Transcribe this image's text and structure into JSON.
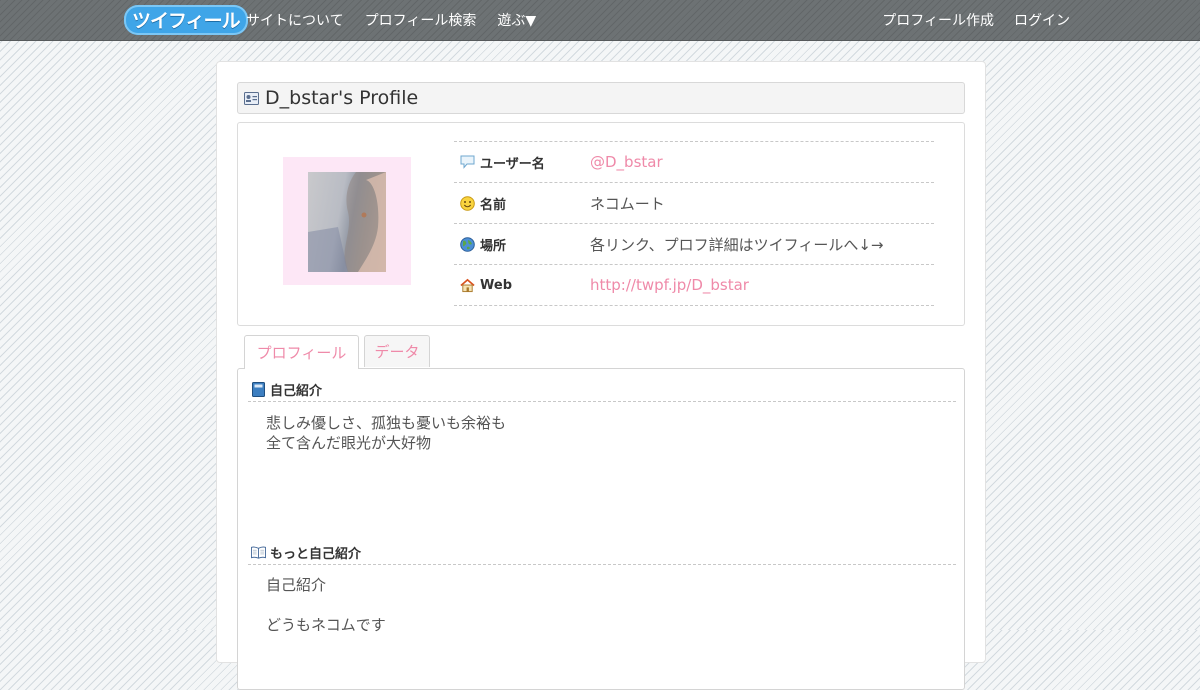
{
  "header": {
    "logo_text": "ツイフィール",
    "nav_left": [
      "サイトについて",
      "プロフィール検索",
      "遊ぶ▼"
    ],
    "nav_right": [
      "プロフィール作成",
      "ログイン"
    ]
  },
  "profile": {
    "title": "D_bstar's Profile",
    "rows": [
      {
        "icon": "speech-bubble-icon",
        "label": "ユーザー名",
        "value": "@D_bstar"
      },
      {
        "icon": "smiley-face-icon",
        "label": "名前",
        "value": "ネコムート"
      },
      {
        "icon": "globe-icon",
        "label": "場所",
        "value": "各リンク、プロフ詳細はツイフィールへ↓→"
      },
      {
        "icon": "house-icon",
        "label": "Web",
        "value": "http://twpf.jp/D_bstar"
      }
    ]
  },
  "tabs": [
    "プロフィール",
    "データ"
  ],
  "sections": {
    "intro": {
      "title": "自己紹介",
      "lines": [
        "悲しみ優しさ、孤独も憂いも余裕も",
        "全て含んだ眼光が大好物"
      ]
    },
    "more_intro": {
      "title": "もっと自己紹介",
      "lines": [
        "自己紹介",
        "",
        "どうもネコムです"
      ]
    }
  },
  "colors": {
    "accent_pink": "#ef8aa9",
    "topbar": "#6d7274",
    "avatar_frame": "#fde7f6"
  }
}
